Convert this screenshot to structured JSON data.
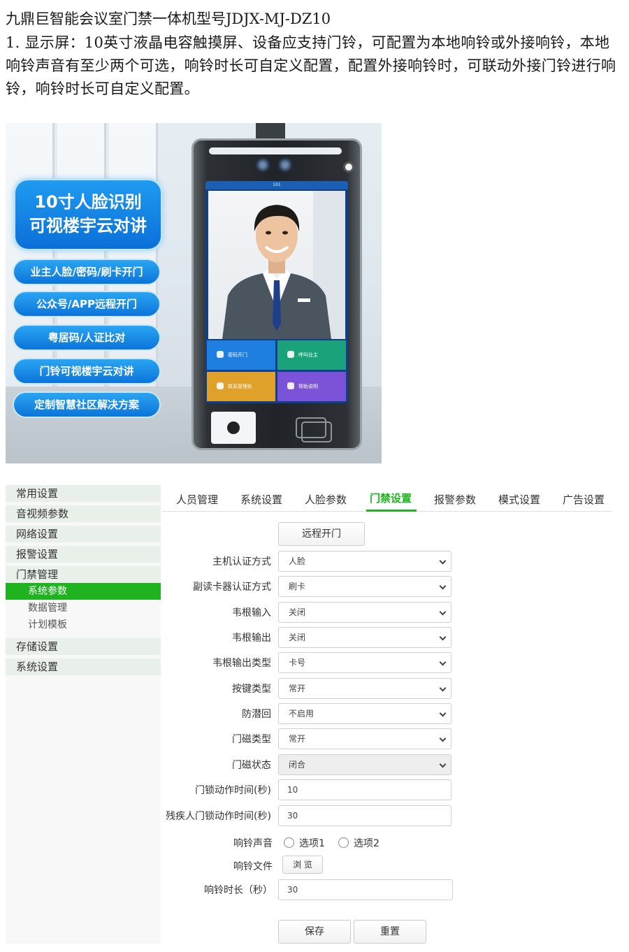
{
  "document": {
    "title": "九鼎巨智能会议室门禁一体机型号JDJX-MJ-DZ10",
    "paragraph": "1. 显示屏：10英寸液晶电容触摸屏、设备应支持门铃，可配置为本地响铃或外接响铃，本地响铃声音有至少两个可选，响铃时长可自定义配置，配置外接响铃时，可联动外接门铃进行响铃，响铃时长可自定义配置。"
  },
  "product_image": {
    "headline_line1": "10寸人脸识别",
    "headline_line2": "可视楼宇云对讲",
    "features": [
      "业主人脸/密码/刷卡开门",
      "公众号/APP远程开门",
      "粤居码/人证比对",
      "门铃可视楼宇云对讲",
      "定制智慧社区解决方案"
    ],
    "screen_status": "101",
    "screen_tiles": [
      "密码开门",
      "呼叫业主",
      "联系管理处",
      "帮助说明"
    ],
    "tile_colors": [
      "#1e7fe0",
      "#1aa37a",
      "#e0a12a",
      "#7b53d6"
    ]
  },
  "sidebar": {
    "items": [
      "常用设置",
      "音视频参数",
      "网络设置",
      "报警设置",
      "门禁管理"
    ],
    "sub_items": [
      "系统参数",
      "数据管理",
      "计划模板"
    ],
    "bottom_items": [
      "存储设置",
      "系统设置"
    ],
    "active_sub": "系统参数"
  },
  "tabs": [
    "人员管理",
    "系统设置",
    "人脸参数",
    "门禁设置",
    "报警参数",
    "模式设置",
    "广告设置"
  ],
  "active_tab": "门禁设置",
  "accent_color": "#1fb31f",
  "form": {
    "remote_open_button": "远程开门",
    "fields": [
      {
        "label": "主机认证方式",
        "value": "人脸"
      },
      {
        "label": "副读卡器认证方式",
        "value": "刷卡"
      },
      {
        "label": "韦根输入",
        "value": "关闭"
      },
      {
        "label": "韦根输出",
        "value": "关闭"
      },
      {
        "label": "韦根输出类型",
        "value": "卡号"
      },
      {
        "label": "按键类型",
        "value": "常开"
      },
      {
        "label": "防潜回",
        "value": "不启用"
      },
      {
        "label": "门磁类型",
        "value": "常开"
      },
      {
        "label": "门磁状态",
        "value": "闭合"
      }
    ],
    "lock_time_label": "门锁动作时间(秒)",
    "lock_time_value": "10",
    "disabled_lock_time_label": "残疾人门锁动作时间(秒)",
    "disabled_lock_time_value": "30",
    "ring_sound_label": "响铃声音",
    "ring_options": [
      "选项1",
      "选项2"
    ],
    "ring_file_label": "响铃文件",
    "browse_button": "浏 览",
    "ring_duration_label": "响铃时长（秒）",
    "ring_duration_value": "30",
    "save_button": "保存",
    "reset_button": "重置"
  }
}
